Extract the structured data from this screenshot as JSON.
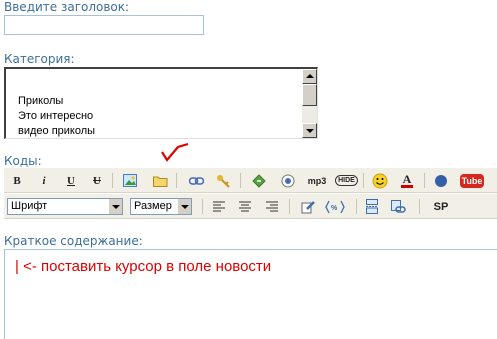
{
  "form": {
    "title_label": "Введите заголовок:",
    "category_label": "Категория:",
    "categories": [
      "Приколы",
      "Это интересно",
      "видео приколы"
    ],
    "codes_label": "Коды:",
    "summary_label": "Краткое содержание:"
  },
  "toolbar": {
    "bold": "B",
    "italic": "i",
    "underline": "U",
    "strike": "U",
    "mp3": "mp3",
    "hide": "HIDE",
    "font_color": "A",
    "youtube": "Tube",
    "font_select": "Шрифт",
    "size_select": "Размер",
    "sp": "SP"
  },
  "annotation": {
    "text": "|  <- поставить курсор в поле новости",
    "color": "#e00000"
  }
}
